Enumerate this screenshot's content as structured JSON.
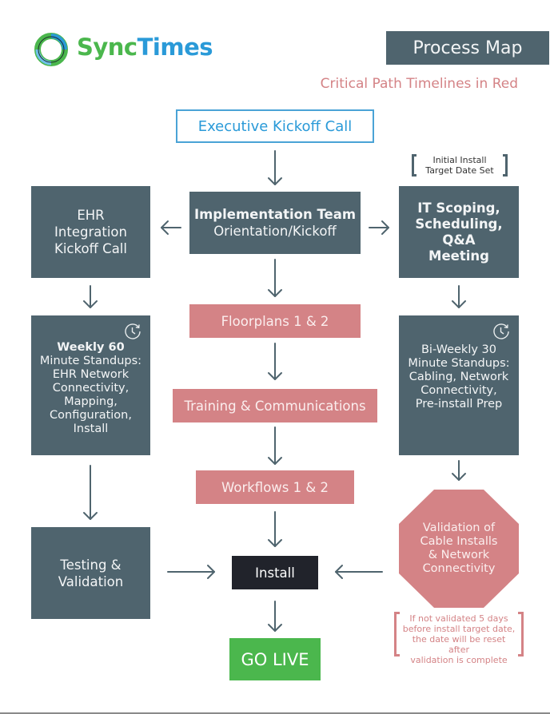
{
  "brand": {
    "logo_part1": "Sync",
    "logo_part2": "Times",
    "logo_icon": "sync-ring-icon",
    "colors": {
      "green": "#4bb74d",
      "blue": "#2a9ad8"
    }
  },
  "header": {
    "title": "Process Map",
    "subtitle": "Critical Path Timelines in Red"
  },
  "colors": {
    "slate": "#4f646e",
    "critical_red": "#d48386",
    "install_dark": "#21232b",
    "go_live_green": "#4bb74d",
    "kickoff_blue": "#2a9ad8"
  },
  "nodes": {
    "executive_kickoff": "Executive Kickoff Call",
    "implementation": {
      "line1": "Implementation Team",
      "line2": "Orientation/Kickoff"
    },
    "ehr_kickoff": "EHR\nIntegration\nKickoff Call",
    "it_scoping": "IT Scoping,\nScheduling,\nQ&A\nMeeting",
    "target_note": "Initial Install\nTarget Date Set",
    "floorplans": "Floorplans 1 & 2",
    "training": "Training & Communications",
    "workflows": "Workflows 1 & 2",
    "weekly": {
      "title": "Weekly 60",
      "body": "Minute Standups:\nEHR Network\nConnectivity,\nMapping,\nConfiguration,\nInstall"
    },
    "biweekly": "Bi-Weekly 30\nMinute Standups:\nCabling, Network\nConnectivity,\nPre-install Prep",
    "testing": "Testing &\nValidation",
    "validation": "Validation of\nCable Installs\n& Network\nConnectivity",
    "reset_note": "If not validated 5 days\nbefore install target date,\nthe date will be reset after\nvalidation is complete",
    "install": "Install",
    "go_live": "GO LIVE"
  },
  "icons": {
    "recurring": "recurring-clock-icon"
  }
}
